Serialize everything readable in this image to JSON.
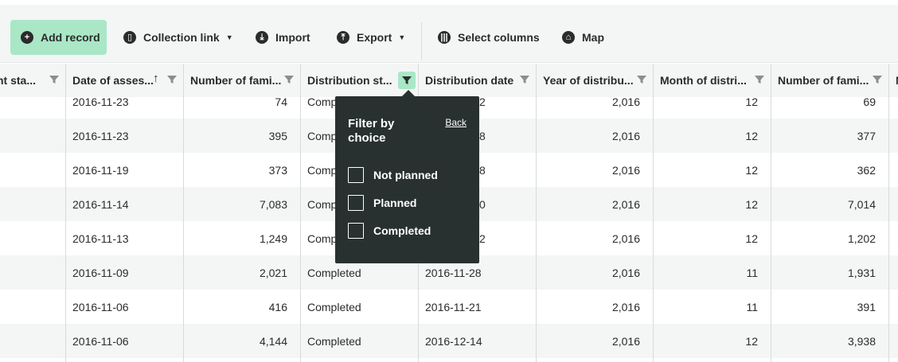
{
  "toolbar": {
    "add_record": "Add record",
    "collection_link": "Collection link",
    "import": "Import",
    "export": "Export",
    "select_columns": "Select columns",
    "map": "Map"
  },
  "columns": [
    "nt sta...",
    "Date of asses...",
    "Number of fami...",
    "Distribution st...",
    "Distribution date",
    "Year of distribu...",
    "Month of distri...",
    "Number of fami...",
    "N"
  ],
  "rows": [
    {
      "date": "2016-11-23",
      "families": "74",
      "status": "Comp",
      "dist_date": "2",
      "year": "2,016",
      "month": "12",
      "families2": "69"
    },
    {
      "date": "2016-11-23",
      "families": "395",
      "status": "Comp",
      "dist_date": "8",
      "year": "2,016",
      "month": "12",
      "families2": "377"
    },
    {
      "date": "2016-11-19",
      "families": "373",
      "status": "Comp",
      "dist_date": "8",
      "year": "2,016",
      "month": "12",
      "families2": "362"
    },
    {
      "date": "2016-11-14",
      "families": "7,083",
      "status": "Comp",
      "dist_date": "0",
      "year": "2,016",
      "month": "12",
      "families2": "7,014"
    },
    {
      "date": "2016-11-13",
      "families": "1,249",
      "status": "Comp",
      "dist_date": "2",
      "year": "2,016",
      "month": "12",
      "families2": "1,202"
    },
    {
      "date": "2016-11-09",
      "families": "2,021",
      "status": "Completed",
      "dist_date": "2016-11-28",
      "year": "2,016",
      "month": "11",
      "families2": "1,931"
    },
    {
      "date": "2016-11-06",
      "families": "416",
      "status": "Completed",
      "dist_date": "2016-11-21",
      "year": "2,016",
      "month": "11",
      "families2": "391"
    },
    {
      "date": "2016-11-06",
      "families": "4,144",
      "status": "Completed",
      "dist_date": "2016-12-14",
      "year": "2,016",
      "month": "12",
      "families2": "3,938"
    }
  ],
  "filter_popover": {
    "title": "Filter by choice",
    "back": "Back",
    "options": [
      "Not planned",
      "Planned",
      "Completed"
    ]
  },
  "colors": {
    "accent": "#a9e7c7",
    "popover_bg": "#283130",
    "header_bg": "#f3f6f5",
    "row_alt_bg": "#f3f6f5",
    "text": "#2b2b2b"
  }
}
